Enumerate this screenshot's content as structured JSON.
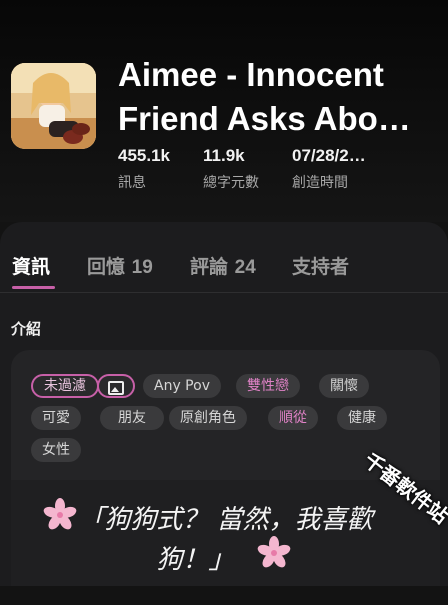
{
  "story": {
    "title_line1": "Aimee - Innocent",
    "title_line2": "Friend Asks Abo…",
    "stats": [
      {
        "value": "455.1k",
        "label": "訊息"
      },
      {
        "value": "11.9k",
        "label": "總字元數"
      },
      {
        "value": "07/28/2…",
        "label": "創造時間"
      }
    ]
  },
  "tabs": [
    {
      "label": "資訊",
      "count": ""
    },
    {
      "label": "回憶",
      "count": "19"
    },
    {
      "label": "評論",
      "count": "24"
    },
    {
      "label": "支持者",
      "count": ""
    }
  ],
  "section": {
    "intro_label": "介紹"
  },
  "tags": [
    {
      "label": "未過濾",
      "style": "outline"
    },
    {
      "label": "",
      "style": "outline",
      "icon": "image-icon"
    },
    {
      "label": "Any Pov",
      "style": "plain"
    },
    {
      "label": "雙性戀",
      "style": "pink"
    },
    {
      "label": "關懷",
      "style": "plain"
    },
    {
      "label": "可愛",
      "style": "plain"
    },
    {
      "label": "朋友",
      "style": "plain"
    },
    {
      "label": "原創角色",
      "style": "plain"
    },
    {
      "label": "順從",
      "style": "pink"
    },
    {
      "label": "健康",
      "style": "plain"
    },
    {
      "label": "女性",
      "style": "plain"
    }
  ],
  "intro_quote": {
    "line1": "「狗狗式？ 當然，我喜歡",
    "line2": "狗！」"
  },
  "watermark": "千番軟件站",
  "colors": {
    "accent": "#c760a8",
    "background": "#131313",
    "panel": "#1c1c1e",
    "tag_bg": "#3a3a3c",
    "flower": "#f4b6cf"
  }
}
